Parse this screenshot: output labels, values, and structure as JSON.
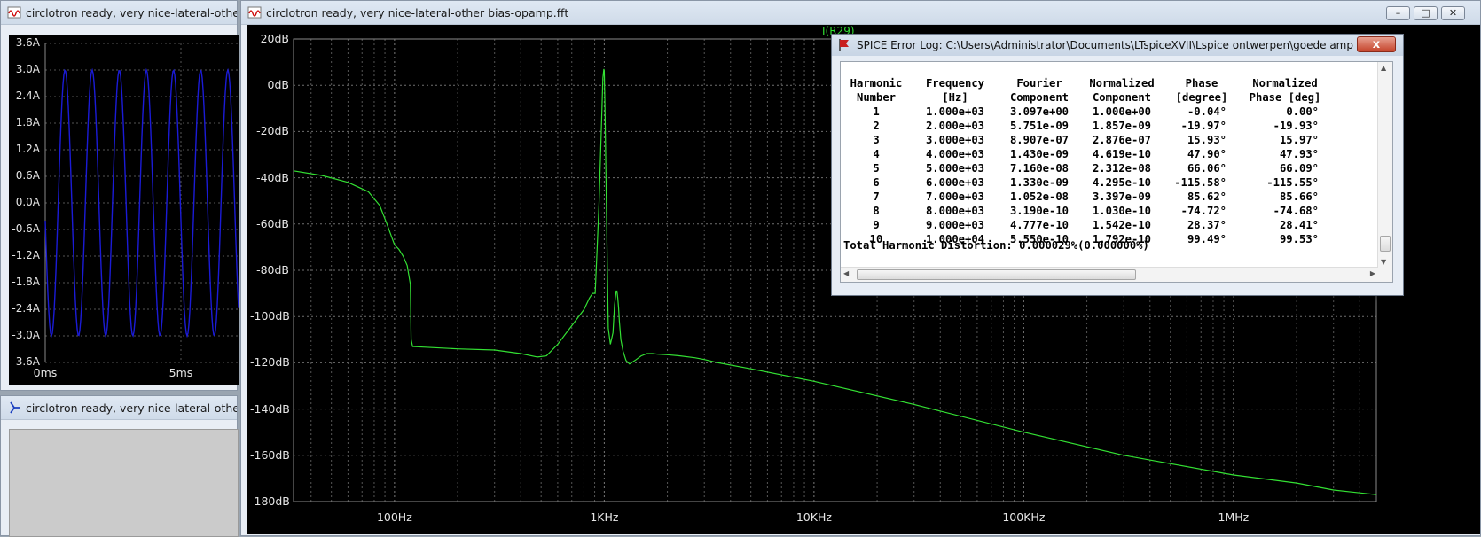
{
  "windows": {
    "time_plot": {
      "title": "circlotron ready, very nice-lateral-other bias-opamp.raw"
    },
    "schematic": {
      "title": "circlotron ready, very nice-lateral-other bias-opamp.asc"
    },
    "fft": {
      "title": "circlotron ready, very nice-lateral-other bias-opamp.fft",
      "trace_label": "I(R29)"
    }
  },
  "time_chart": {
    "y_ticks": [
      "3.6A",
      "3.0A",
      "2.4A",
      "1.8A",
      "1.2A",
      "0.6A",
      "0.0A",
      "-0.6A",
      "-1.2A",
      "-1.8A",
      "-2.4A",
      "-3.0A",
      "-3.6A"
    ],
    "x_ticks": [
      "0ms",
      "5ms"
    ],
    "trace_color": "#1b1bd6"
  },
  "chart_data": {
    "type": "line",
    "xlabel": "",
    "ylabel": "",
    "x_scale": "log",
    "xlim": [
      33,
      4800000
    ],
    "ylim": [
      -180,
      20
    ],
    "x_ticks": [
      "100Hz",
      "1KHz",
      "10KHz",
      "100KHz",
      "1MHz"
    ],
    "y_ticks": [
      "20dB",
      "0dB",
      "-20dB",
      "-40dB",
      "-60dB",
      "-80dB",
      "-100dB",
      "-120dB",
      "-140dB",
      "-160dB",
      "-180dB"
    ],
    "grid": true,
    "series": [
      {
        "name": "I(R29)",
        "color": "#33e033",
        "x": [
          33,
          45,
          60,
          75,
          85,
          92,
          100,
          105,
          110,
          115,
          119,
          120,
          122,
          200,
          300,
          400,
          480,
          530,
          600,
          700,
          800,
          850,
          880,
          905,
          925,
          945,
          960,
          975,
          985,
          995,
          1000,
          1010,
          1025,
          1045,
          1070,
          1100,
          1120,
          1140,
          1150,
          1160,
          1170,
          1180,
          1200,
          1230,
          1270,
          1320,
          1400,
          1500,
          1600,
          1700,
          1800,
          2000,
          2300,
          2700,
          3000,
          3500,
          5000,
          10000,
          30000,
          100000,
          300000,
          1000000,
          2000000,
          3000000,
          4800000
        ],
        "y": [
          -37,
          -39,
          -42,
          -46,
          -52,
          -60,
          -69,
          -71,
          -74,
          -78,
          -86,
          -110,
          -113,
          -114,
          -114.5,
          -116,
          -117.5,
          -117,
          -112,
          -104,
          -97,
          -92,
          -90,
          -90,
          -70,
          -50,
          -30,
          -10,
          3,
          7,
          6,
          -15,
          -55,
          -105,
          -112,
          -107,
          -95,
          -89,
          -89,
          -92,
          -96,
          -102,
          -110,
          -115,
          -119,
          -120.5,
          -119,
          -117,
          -116,
          -116,
          -116.3,
          -116.5,
          -117,
          -117.8,
          -118.6,
          -120,
          -122.6,
          -128,
          -138,
          -150,
          -160,
          -168.5,
          -172,
          -175,
          -177
        ]
      }
    ]
  },
  "error_log": {
    "title": "SPICE Error Log: C:\\Users\\Administrator\\Documents\\LTspiceXVII\\Lspice ontwerpen\\goede amps\\circlotro...",
    "close_label": "x",
    "headers": [
      [
        "Harmonic",
        "Number"
      ],
      [
        "Frequency",
        "[Hz]"
      ],
      [
        "Fourier",
        "Component"
      ],
      [
        "Normalized",
        "Component"
      ],
      [
        "Phase",
        "[degree]"
      ],
      [
        "Normalized",
        "Phase [deg]"
      ]
    ],
    "rows": [
      [
        "1",
        "1.000e+03",
        "3.097e+00",
        "1.000e+00",
        "-0.04°",
        "0.00°"
      ],
      [
        "2",
        "2.000e+03",
        "5.751e-09",
        "1.857e-09",
        "-19.97°",
        "-19.93°"
      ],
      [
        "3",
        "3.000e+03",
        "8.907e-07",
        "2.876e-07",
        "15.93°",
        "15.97°"
      ],
      [
        "4",
        "4.000e+03",
        "1.430e-09",
        "4.619e-10",
        "47.90°",
        "47.93°"
      ],
      [
        "5",
        "5.000e+03",
        "7.160e-08",
        "2.312e-08",
        "66.06°",
        "66.09°"
      ],
      [
        "6",
        "6.000e+03",
        "1.330e-09",
        "4.295e-10",
        "-115.58°",
        "-115.55°"
      ],
      [
        "7",
        "7.000e+03",
        "1.052e-08",
        "3.397e-09",
        "85.62°",
        "85.66°"
      ],
      [
        "8",
        "8.000e+03",
        "3.190e-10",
        "1.030e-10",
        "-74.72°",
        "-74.68°"
      ],
      [
        "9",
        "9.000e+03",
        "4.777e-10",
        "1.542e-10",
        "28.37°",
        "28.41°"
      ],
      [
        "10",
        "1.000e+04",
        "5.550e-10",
        "1.792e-10",
        "99.49°",
        "99.53°"
      ]
    ],
    "thd": "Total Harmonic Distortion: 0.000029%(0.000000%)"
  }
}
